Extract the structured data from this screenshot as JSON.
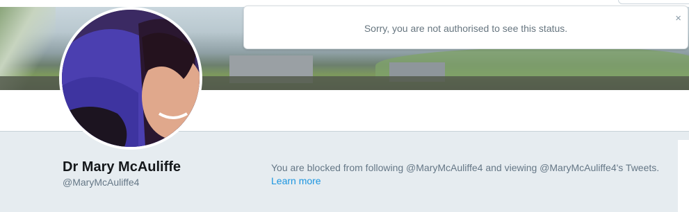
{
  "toast": {
    "message": "Sorry, you are not authorised to see this status.",
    "close_glyph": "×"
  },
  "profile": {
    "name": "Dr Mary McAuliffe",
    "handle": "@MaryMcAuliffe4"
  },
  "blocked_notice": {
    "text": "You are blocked from following @MaryMcAuliffe4 and viewing @MaryMcAuliffe4's Tweets.",
    "link": "Learn more"
  },
  "colors": {
    "link": "#1b95e0",
    "muted": "#657786",
    "background": "#e6ecf0"
  },
  "icons": {
    "close": "close-icon"
  }
}
